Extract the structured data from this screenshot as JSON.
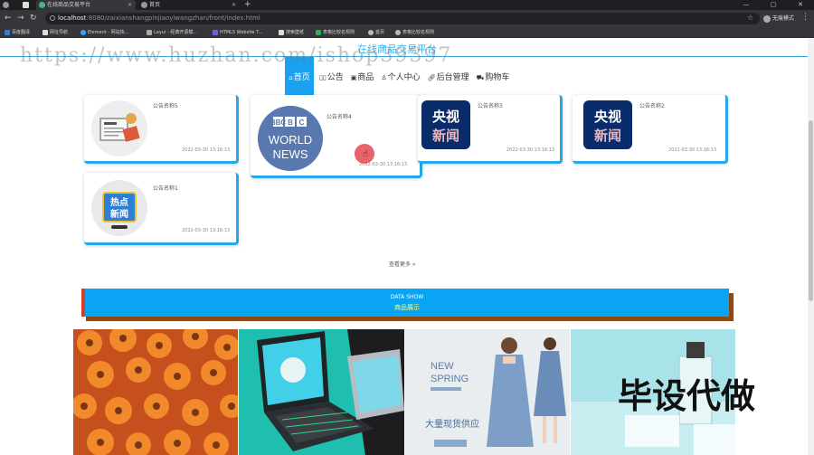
{
  "browser": {
    "tabs": [
      {
        "label": ""
      },
      {
        "label": "在线商品交易平台"
      },
      {
        "label": "首页"
      }
    ],
    "new_tab": "+",
    "window": {
      "min": "—",
      "max": "▢",
      "close": "✕"
    },
    "url_host": "localhost",
    "url_path": ":8080/zaixianshangpinjiaoyiwangzhan/front/index.html",
    "guest_label": "无痕模式",
    "bookmarks": [
      "百度翻译",
      "网址导航",
      "Element - 网站快...",
      "Layui - 经典开源模...",
      "HTML5 Website T...",
      "搜索壁纸",
      "表格比较名规则",
      "首页",
      "表格比较名规则"
    ]
  },
  "site": {
    "title": "在线商品交易平台",
    "nav": [
      {
        "label": "首页",
        "icon": "home-icon"
      },
      {
        "label": "公告",
        "icon": "notice-icon"
      },
      {
        "label": "商品",
        "icon": "goods-icon"
      },
      {
        "label": "个人中心",
        "icon": "user-icon"
      },
      {
        "label": "后台管理",
        "icon": "link-icon"
      },
      {
        "label": "购物车",
        "icon": "cart-icon"
      }
    ],
    "notices": [
      {
        "title": "公告名称5",
        "date": "2022-03-30 13:16:13"
      },
      {
        "title": "公告名称4",
        "date": "2022-03-30 13:16:13"
      },
      {
        "title": "公告名称3",
        "date": "2022-03-30 13:16:13"
      },
      {
        "title": "公告名称2",
        "date": "2022-03-30 13:16:13"
      },
      {
        "title": "公告名称1",
        "date": "2022-03-30 13:16:13"
      }
    ],
    "see_more": "查看更多 »",
    "data_show_en": "DATA SHOW",
    "data_show_cn": "商品展示",
    "products": [
      {
        "caption": ""
      },
      {
        "caption": ""
      },
      {
        "caption": "NEW SPRING",
        "sub": "大量现货供应"
      },
      {
        "caption": ""
      }
    ],
    "thumbs": {
      "bbc1": "BBC",
      "bbc2": "WORLD",
      "bbc3": "NEWS",
      "cctv1": "央视",
      "cctv2": "新闻",
      "hot1": "热点",
      "hot2": "新闻"
    }
  },
  "watermarks": {
    "url": "https://www.huzhan.com/ishop39397",
    "cn": "毕设代做"
  },
  "colors": {
    "accent": "#1aa2f0",
    "title": "#3ab0e8",
    "cctv": "#0b2c6b"
  }
}
